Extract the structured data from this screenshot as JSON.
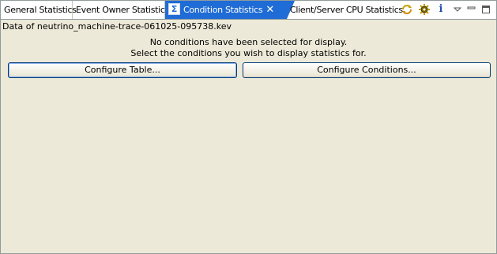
{
  "tabs": [
    {
      "label": "General Statistics"
    },
    {
      "label": "Event Owner Statistics"
    },
    {
      "label": "Condition Statistics",
      "icon": "sigma-icon",
      "active": true
    },
    {
      "label": "Client/Server CPU Statistics"
    }
  ],
  "toolbar": {
    "icons": [
      "sync-icon",
      "settings-gear-icon",
      "info-icon",
      "view-menu-icon",
      "minimize-icon",
      "maximize-icon"
    ]
  },
  "content": {
    "file_label": "Data of neutrino_machine-trace-061025-095738.kev",
    "message_line1": "No conditions have been selected for display.",
    "message_line2": "Select the conditions you wish to display statistics for.",
    "configure_table_label": "Configure Table...",
    "configure_conditions_label": "Configure Conditions..."
  },
  "colors": {
    "active_tab": "#1f6cd6",
    "panel_background": "#ece9d8",
    "button_border": "#003c74"
  }
}
